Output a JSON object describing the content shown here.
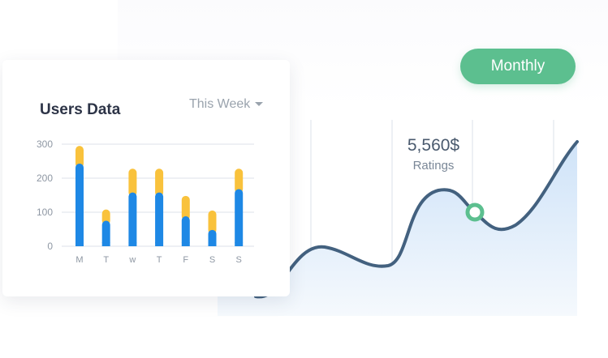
{
  "monthly_button": {
    "label": "Monthly"
  },
  "rating": {
    "value": "5,560$",
    "label": "Ratings"
  },
  "users_card": {
    "title": "Users Data",
    "period": "This Week"
  },
  "colors": {
    "accent_green": "#5cbf8f",
    "line": "#43617f",
    "bar_blue": "#1e88e5",
    "bar_yellow": "#f9c23c"
  },
  "chart_data": {
    "type": "bar",
    "stacked": true,
    "title": "Users Data",
    "categories": [
      "M",
      "T",
      "w",
      "T",
      "F",
      "S",
      "S"
    ],
    "series": [
      {
        "values": [
          243,
          75,
          158,
          158,
          88,
          48,
          168
        ]
      },
      {
        "values": [
          52,
          33,
          70,
          70,
          60,
          57,
          60
        ]
      }
    ],
    "yticks": [
      0,
      100,
      200,
      300
    ],
    "ylim": [
      0,
      300
    ],
    "grid": true
  }
}
